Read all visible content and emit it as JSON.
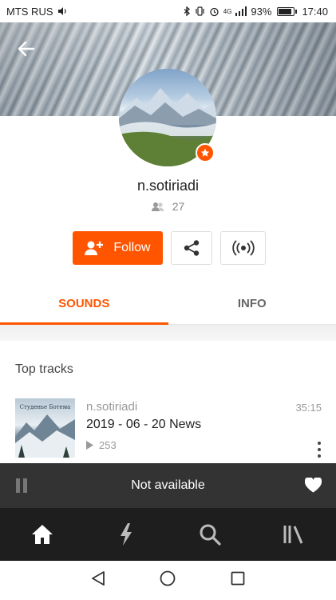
{
  "status_bar": {
    "carrier": "MTS RUS",
    "network": "4G",
    "battery_percent": "93%",
    "time": "17:40"
  },
  "profile": {
    "username": "n.sotiriadi",
    "followers_count": "27"
  },
  "actions": {
    "follow_label": "Follow"
  },
  "tabs": [
    {
      "label": "SOUNDS",
      "active": true
    },
    {
      "label": "INFO",
      "active": false
    }
  ],
  "section": {
    "title": "Top tracks"
  },
  "tracks": [
    {
      "artwork_text": "Студенье Ботема",
      "artist": "n.sotiriadi",
      "title": "2019 - 06 - 20 News",
      "duration": "35:15",
      "plays": "253"
    }
  ],
  "player": {
    "status": "Not available"
  },
  "colors": {
    "accent": "#ff5500",
    "player_bg": "#333333",
    "nav_bg": "#1e1e1e"
  },
  "icons": {
    "back": "arrow-left-icon",
    "follow": "add-user-icon",
    "share": "share-icon",
    "station": "station-icon",
    "home": "home-icon",
    "stream": "lightning-icon",
    "search": "search-icon",
    "library": "library-icon",
    "like": "heart-icon"
  }
}
